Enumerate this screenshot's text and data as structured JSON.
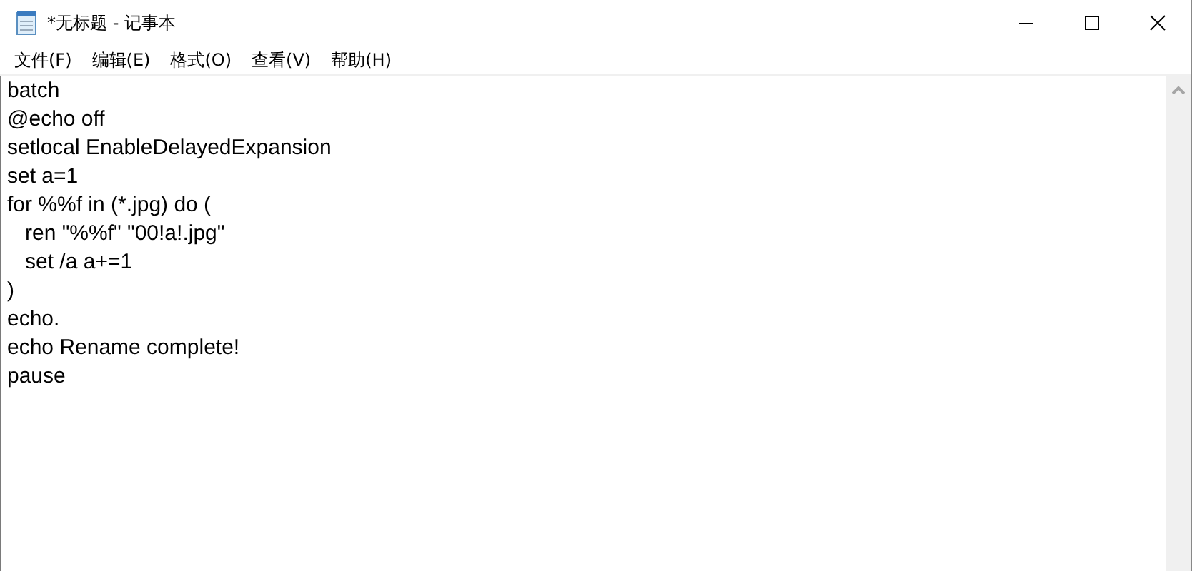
{
  "window": {
    "title": "*无标题 - 记事本"
  },
  "menu": [
    {
      "label": "文件(F)"
    },
    {
      "label": "编辑(E)"
    },
    {
      "label": "格式(O)"
    },
    {
      "label": "查看(V)"
    },
    {
      "label": "帮助(H)"
    }
  ],
  "editor": {
    "lines": [
      "batch",
      "@echo off",
      "setlocal EnableDelayedExpansion",
      "set a=1",
      "for %%f in (*.jpg) do (",
      "   ren \"%%f\" \"00!a!.jpg\"",
      "   set /a a+=1",
      ")",
      "echo.",
      "echo Rename complete!",
      "pause"
    ]
  }
}
